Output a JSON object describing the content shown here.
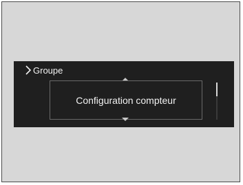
{
  "breadcrumb": {
    "label": "Groupe",
    "icon": "chevron-right-icon"
  },
  "menu": {
    "selected_item": "Configuration compteur",
    "up_icon": "triangle-up-icon",
    "down_icon": "triangle-down-icon"
  },
  "colors": {
    "screen_background": "#1f1f1f",
    "text": "#f2f2f2",
    "item_border": "#6a6a6a",
    "scroll_thumb": "#d9d9d9"
  },
  "scroll": {
    "position_fraction": 0
  }
}
